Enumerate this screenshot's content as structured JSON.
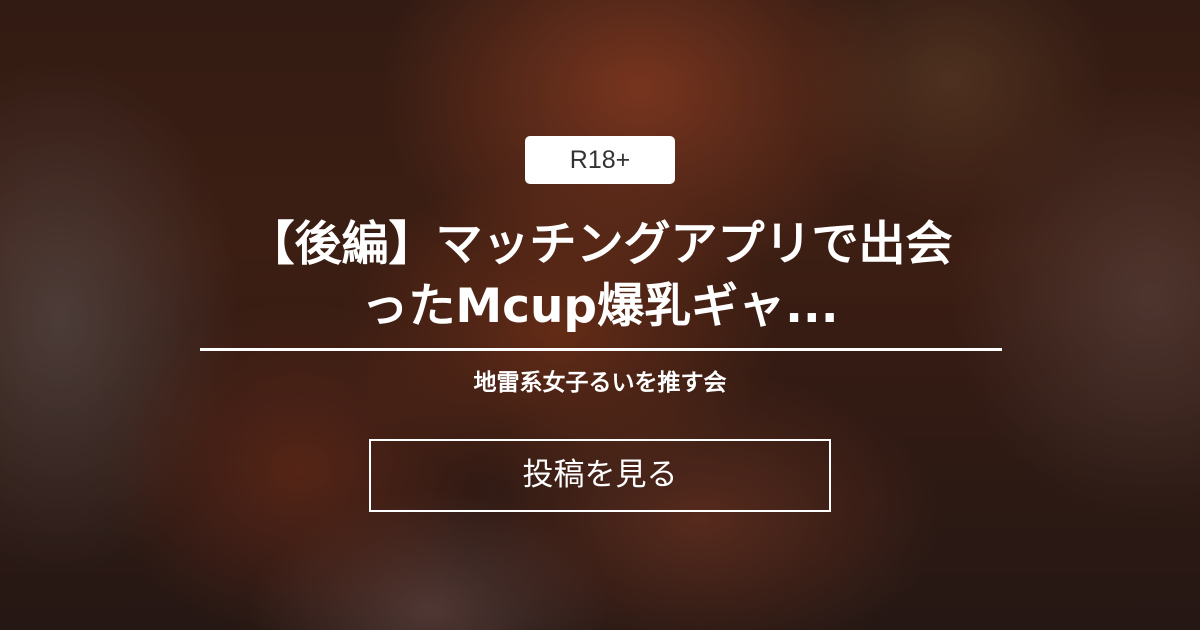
{
  "rating_badge": "R18+",
  "title_lines": [
    "【後編】マッチングアプリで出会",
    "ったMcup爆乳ギャ..."
  ],
  "creator_name": "地雷系女子るいを推す会",
  "view_posts_label": "投稿を見る",
  "colors": {
    "badge_background": "#ffffff",
    "badge_text": "#333333",
    "text": "#ffffff",
    "button_border": "#ffffff"
  }
}
